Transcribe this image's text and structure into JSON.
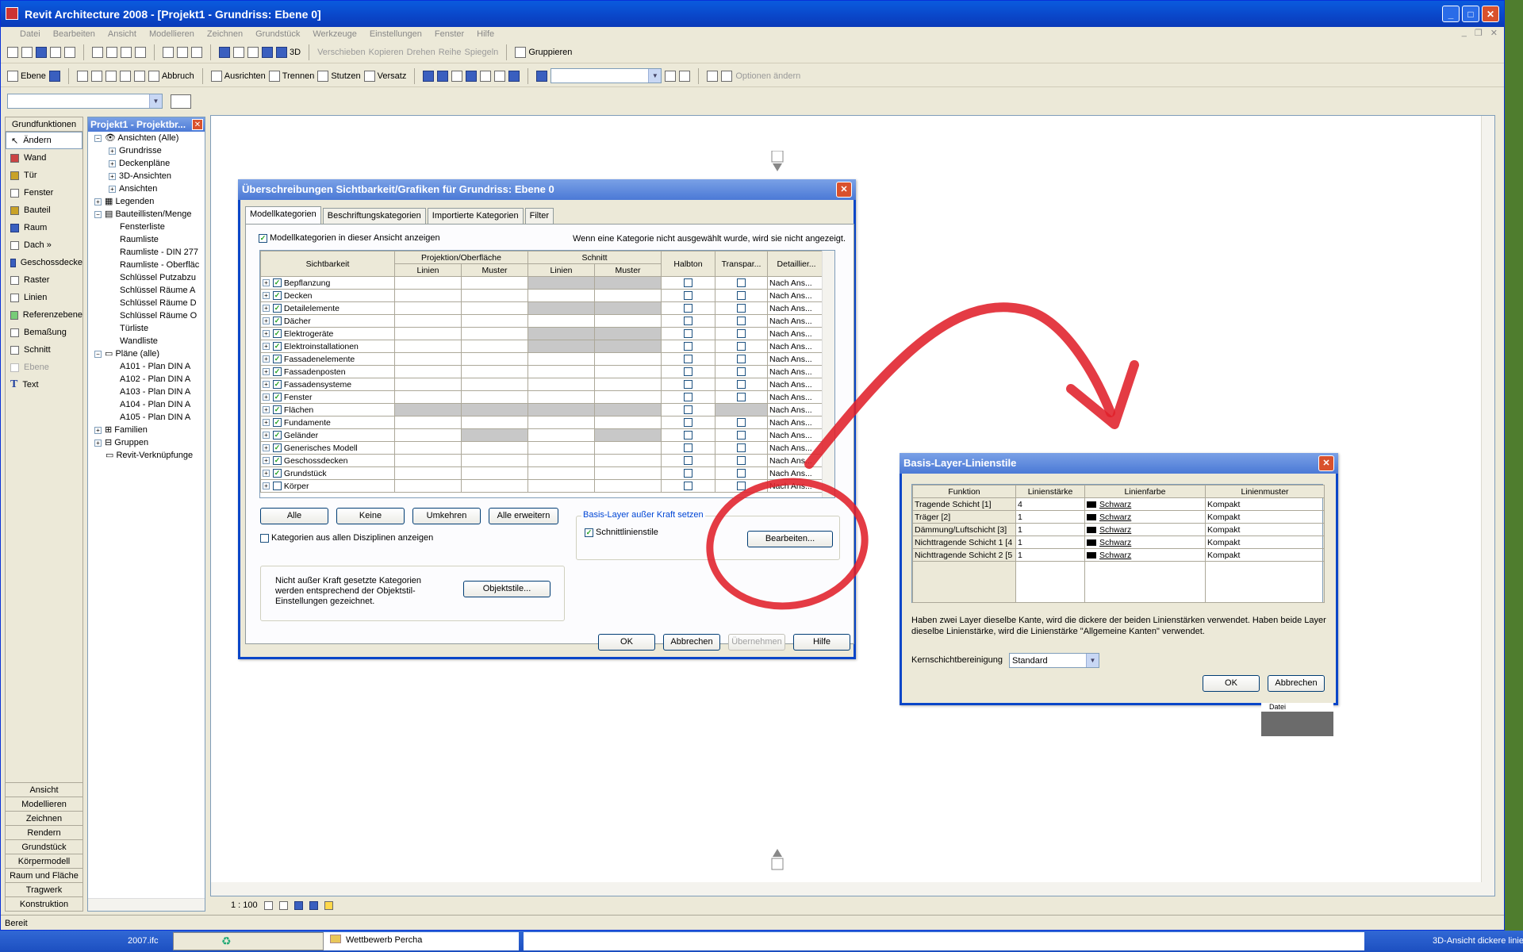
{
  "window": {
    "title": "Revit Architecture 2008 - [Projekt1 - Grundriss: Ebene 0]"
  },
  "menu": [
    "Datei",
    "Bearbeiten",
    "Ansicht",
    "Modellieren",
    "Zeichnen",
    "Grundstück",
    "Werkzeuge",
    "Einstellungen",
    "Fenster",
    "Hilfe"
  ],
  "toolbar1": {
    "view3d": "3D",
    "verschieben": "Verschieben",
    "kopieren": "Kopieren",
    "drehen": "Drehen",
    "reihe": "Reihe",
    "spiegeln": "Spiegeln",
    "gruppieren": "Gruppieren"
  },
  "toolbar2": {
    "ebene": "Ebene",
    "abbruch": "Abbruch",
    "ausrichten": "Ausrichten",
    "trennen": "Trennen",
    "stutzen": "Stutzen",
    "versatz": "Versatz",
    "optionen": "Optionen ändern"
  },
  "design_bar": {
    "header": "Grundfunktionen",
    "items": [
      "Ändern",
      "Wand",
      "Tür",
      "Fenster",
      "Bauteil",
      "Raum",
      "Dach »",
      "Geschossdecke",
      "Raster",
      "Linien",
      "Referenzebene",
      "Bemaßung",
      "Schnitt",
      "Ebene",
      "Text"
    ],
    "tabs": [
      "Ansicht",
      "Modellieren",
      "Zeichnen",
      "Rendern",
      "Grundstück",
      "Körpermodell",
      "Raum und Fläche",
      "Tragwerk",
      "Konstruktion"
    ]
  },
  "project_browser": {
    "title": "Projekt1 - Projektbr...",
    "tree": [
      "Ansichten (Alle)",
      "Grundrisse",
      "Deckenpläne",
      "3D-Ansichten",
      "Ansichten",
      "Legenden",
      "Bauteillisten/Menge",
      "Fensterliste",
      "Raumliste",
      "Raumliste - DIN 277",
      "Raumliste - Oberfläc",
      "Schlüssel Putzabzu",
      "Schlüssel Räume A",
      "Schlüssel Räume D",
      "Schlüssel Räume O",
      "Türliste",
      "Wandliste",
      "Pläne (alle)",
      "A101 - Plan DIN A",
      "A102 - Plan DIN A",
      "A103 - Plan DIN A",
      "A104 - Plan DIN A",
      "A105 - Plan DIN A",
      "Familien",
      "Gruppen",
      "Revit-Verknüpfunge"
    ]
  },
  "vg_dialog": {
    "title": "Überschreibungen Sichtbarkeit/Grafiken für Grundriss: Ebene 0",
    "tabs": [
      "Modellkategorien",
      "Beschriftungskategorien",
      "Importierte Kategorien",
      "Filter"
    ],
    "show_label": "Modellkategorien in dieser Ansicht anzeigen",
    "hint": "Wenn eine Kategorie nicht ausgewählt wurde, wird sie nicht angezeigt.",
    "headers": {
      "sichtbarkeit": "Sichtbarkeit",
      "proj": "Projektion/Oberfläche",
      "schnitt": "Schnitt",
      "halbton": "Halbton",
      "transp": "Transpar...",
      "detail": "Detaillier...",
      "linien": "Linien",
      "muster": "Muster"
    },
    "rows": [
      "Bepflanzung",
      "Decken",
      "Detailelemente",
      "Dächer",
      "Elektrogeräte",
      "Elektroinstallationen",
      "Fassadenelemente",
      "Fassadenposten",
      "Fassadensysteme",
      "Fenster",
      "Flächen",
      "Fundamente",
      "Geländer",
      "Generisches Modell",
      "Geschossdecken",
      "Grundstück",
      "Körper"
    ],
    "detail_value": "Nach Ans...",
    "btn_alle": "Alle",
    "btn_keine": "Keine",
    "btn_umkehren": "Umkehren",
    "btn_erweitern": "Alle erweitern",
    "disciplines": "Kategorien aus allen Disziplinen anzeigen",
    "note": "Nicht außer Kraft gesetzte Kategorien werden entsprechend der Objektstil-Einstellungen gezeichnet.",
    "btn_objektstile": "Objektstile...",
    "basis_group": "Basis-Layer außer Kraft setzen",
    "schnittlinienstile": "Schnittlinienstile",
    "btn_bearbeiten": "Bearbeiten...",
    "ok": "OK",
    "abbrechen": "Abbrechen",
    "uebernehmen": "Übernehmen",
    "hilfe": "Hilfe"
  },
  "layer_dialog": {
    "title": "Basis-Layer-Linienstile",
    "headers": [
      "Funktion",
      "Linienstärke",
      "Linienfarbe",
      "Linienmuster"
    ],
    "rows": [
      {
        "f": "Tragende Schicht [1]",
        "s": "4",
        "c": "Schwarz",
        "m": "Kompakt"
      },
      {
        "f": "Träger [2]",
        "s": "1",
        "c": "Schwarz",
        "m": "Kompakt"
      },
      {
        "f": "Dämmung/Luftschicht [3]",
        "s": "1",
        "c": "Schwarz",
        "m": "Kompakt"
      },
      {
        "f": "Nichttragende Schicht 1 [4",
        "s": "1",
        "c": "Schwarz",
        "m": "Kompakt"
      },
      {
        "f": "Nichttragende Schicht 2 [5",
        "s": "1",
        "c": "Schwarz",
        "m": "Kompakt"
      }
    ],
    "note": "Haben zwei Layer dieselbe Kante, wird die dickere der beiden Linienstärken verwendet. Haben beide Layer dieselbe Linienstärke, wird die Linienstärke \"Allgemeine Kanten\" verwendet.",
    "kern_label": "Kernschichtbereinigung",
    "kern_value": "Standard",
    "ok": "OK",
    "abbrechen": "Abbrechen",
    "popup": "Datei"
  },
  "viewbar": {
    "scale": "1 : 100"
  },
  "status": {
    "text": "Bereit"
  },
  "taskbar": {
    "item1": "2007.ifc",
    "item2": "Wettbewerb Percha",
    "item3": "3D-Ansicht dickere linie"
  },
  "annotation_color": "#e0202a"
}
